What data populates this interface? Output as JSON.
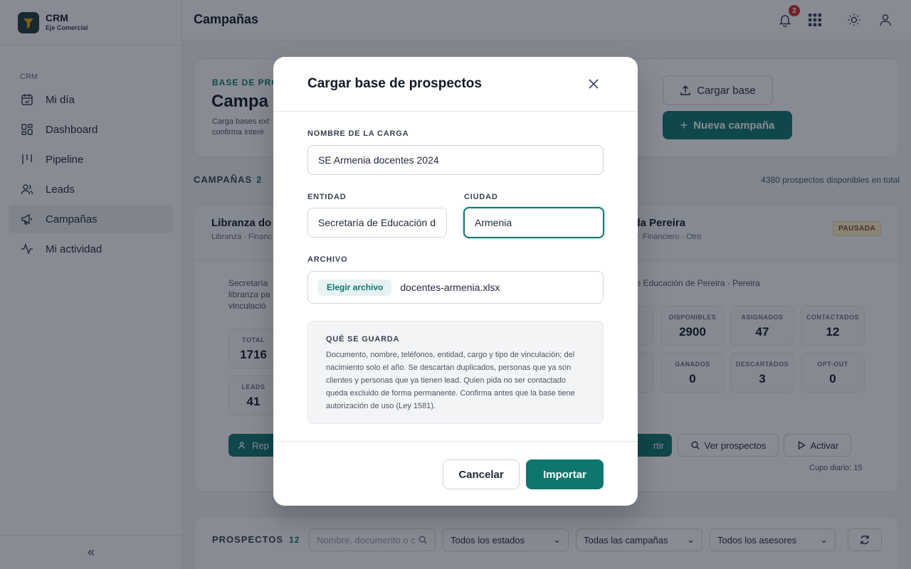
{
  "brand": {
    "title": "CRM",
    "subtitle": "Eje Comercial"
  },
  "sidebar": {
    "section": "CRM",
    "items": [
      {
        "label": "Mi día",
        "icon": "calendar-check-icon"
      },
      {
        "label": "Dashboard",
        "icon": "dashboard-grid-icon"
      },
      {
        "label": "Pipeline",
        "icon": "pipeline-columns-icon"
      },
      {
        "label": "Leads",
        "icon": "users-icon"
      },
      {
        "label": "Campañas",
        "icon": "megaphone-icon",
        "active": true
      },
      {
        "label": "Mi actividad",
        "icon": "activity-icon"
      }
    ],
    "collapse": "«"
  },
  "header": {
    "title": "Campañas",
    "notifications": "2"
  },
  "hero": {
    "eyebrow": "BASE DE PRO",
    "title": "Campa",
    "desc": "Carga bases ext confirma interé",
    "upload_button": "Cargar base",
    "new_button": "Nueva campaña"
  },
  "campaigns": {
    "label": "CAMPAÑAS",
    "count": "2",
    "total_available": "4380 prospectos disponibles en total"
  },
  "campaign_left": {
    "title": "Libranza do",
    "sub": "Libranza · Financ",
    "desc": "Secretaría libranza pa vinculació",
    "stats": [
      {
        "label": "TOTAL",
        "value": "1716"
      },
      {
        "label": "LEADS",
        "value": "41"
      }
    ],
    "action": "Rep"
  },
  "campaign_right": {
    "title": "vida Pereira",
    "sub": "mo · Financiero · Otro",
    "status": "PAUSADA",
    "desc": "le Educación de Pereira · Pereira",
    "stats": [
      {
        "label": "DISPONIBLES",
        "value": "2900"
      },
      {
        "label": "ASIGNADOS",
        "value": "47"
      },
      {
        "label": "CONTACTADOS",
        "value": "12"
      },
      {
        "label": "GANADOS",
        "value": "0"
      },
      {
        "label": "DESCARTADOS",
        "value": "3"
      },
      {
        "label": "OPT-OUT",
        "value": "0"
      }
    ],
    "partial_button": "rtir",
    "view_button": "Ver prospectos",
    "activate_button": "Activar",
    "cupo": "Cupo diario: 15"
  },
  "prospects": {
    "label": "PROSPECTOS",
    "count": "12",
    "search_placeholder": "Nombre, documento o c",
    "filter_states": "Todos los estados",
    "filter_campaigns": "Todas las campañas",
    "filter_advisors": "Todos los asesores"
  },
  "modal": {
    "title": "Cargar base de prospectos",
    "name_label": "NOMBRE DE LA CARGA",
    "name_value": "SE Armenia docentes 2024",
    "entity_label": "ENTIDAD",
    "entity_value": "Secretaría de Educación de Armenia",
    "city_label": "CIUDAD",
    "city_value": "Armenia",
    "file_label": "ARCHIVO",
    "file_button": "Elegir archivo",
    "file_name": "docentes-armenia.xlsx",
    "info_title": "QUÉ SE GUARDA",
    "info_text": "Documento, nombre, teléfonos, entidad, cargo y tipo de vinculación; del nacimiento solo el año. Se descartan duplicados, personas que ya son clientes y personas que ya tienen lead. Quien pida no ser contactado queda excluido de forma permanente. Confirma antes que la base tiene autorización de uso (Ley 1581).",
    "cancel": "Cancelar",
    "import": "Importar"
  },
  "colors": {
    "accent": "#0f766e",
    "badge": "#dc2626",
    "paused": "#fef3c7"
  }
}
